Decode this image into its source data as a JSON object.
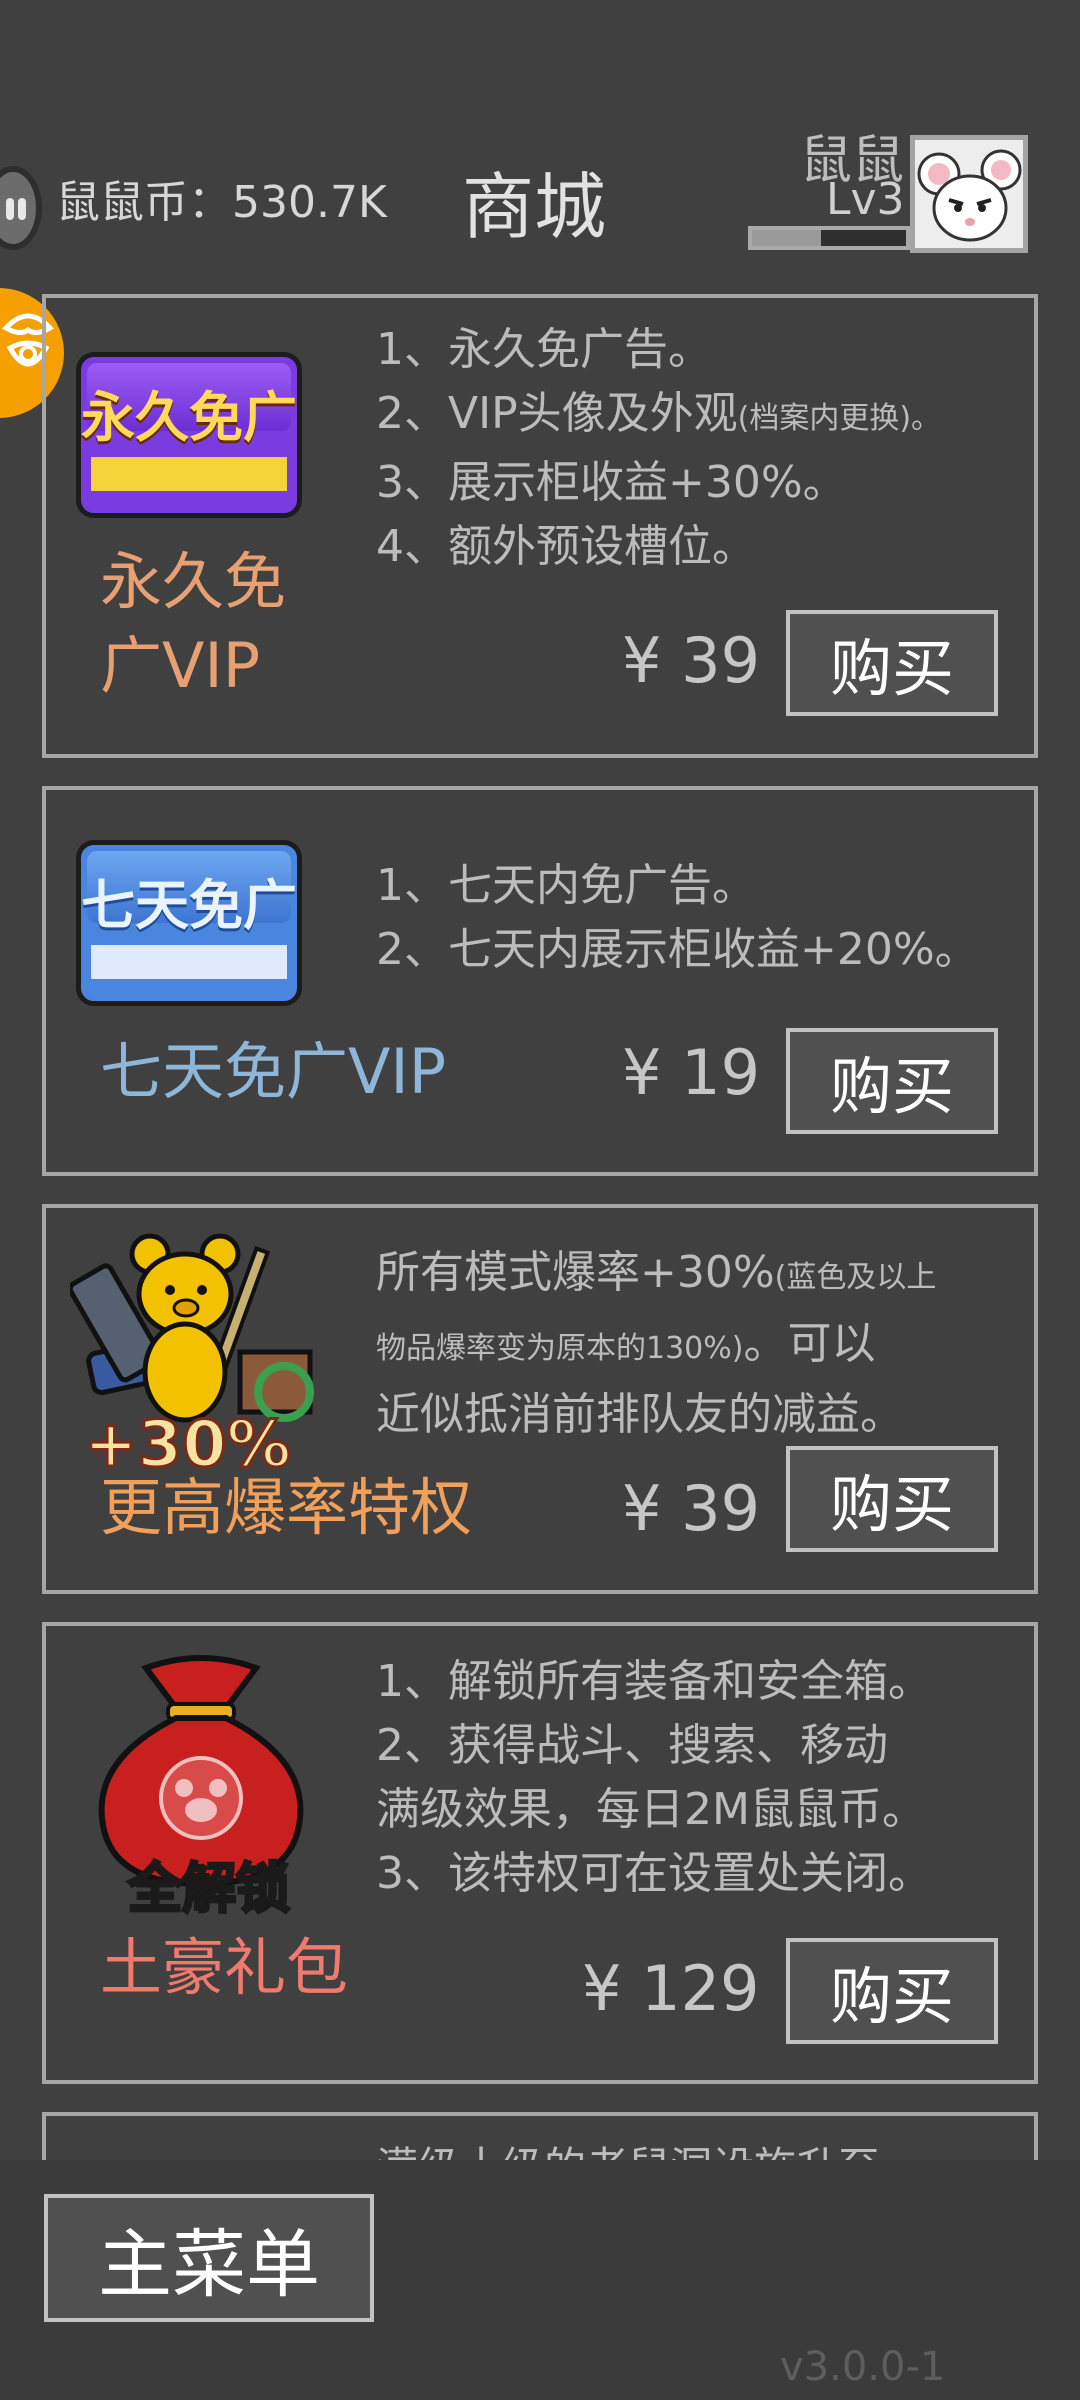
{
  "header": {
    "coins_label": "鼠鼠币：530.7K",
    "title": "商城",
    "username": "鼠鼠",
    "level": "Lv3",
    "xp_progress": 0.45
  },
  "items": [
    {
      "image_text": "永久免广",
      "desc": [
        "1、永久免广告。",
        "2、VIP头像及外观",
        "(档案内更换)。",
        "3、展示柜收益+30%。",
        "4、额外预设槽位。"
      ],
      "name_line1": "永久免",
      "name_line2": "广VIP",
      "price": "¥ 39",
      "buy_label": "购买"
    },
    {
      "image_text": "七天免广",
      "desc": [
        "1、七天内免广告。",
        "2、七天内展示柜收益+20%。"
      ],
      "name": "七天免广VIP",
      "price": "¥ 19",
      "buy_label": "购买"
    },
    {
      "image_text": "+30%",
      "desc": [
        "所有模式爆率+30%",
        "(蓝色及以上",
        "物品爆率变为原本的130%)",
        "。可以",
        "近似抵消前排队友的减益。"
      ],
      "name": "更高爆率特权",
      "price": "¥ 39",
      "buy_label": "购买"
    },
    {
      "image_text": "全解锁",
      "desc": [
        "1、解锁所有装备和安全箱。",
        "2、获得战斗、搜索、移动",
        "满级效果，每日2M鼠鼠币。",
        "3、该特权可在设置处关闭。"
      ],
      "name": "土豪礼包",
      "price": "¥ 129",
      "buy_label": "购买"
    },
    {
      "desc": [
        "满级十级的老鼠洞设施升至"
      ]
    }
  ],
  "footer": {
    "main_menu_label": "主菜单",
    "version": "v3.0.0-1"
  },
  "colors": {
    "background": "#404040",
    "vip_name": "#e8a072",
    "seven_day_name": "#8eb6d8",
    "drop_rate_name": "#f0a05a",
    "tycoon_name": "#f07a6e"
  }
}
